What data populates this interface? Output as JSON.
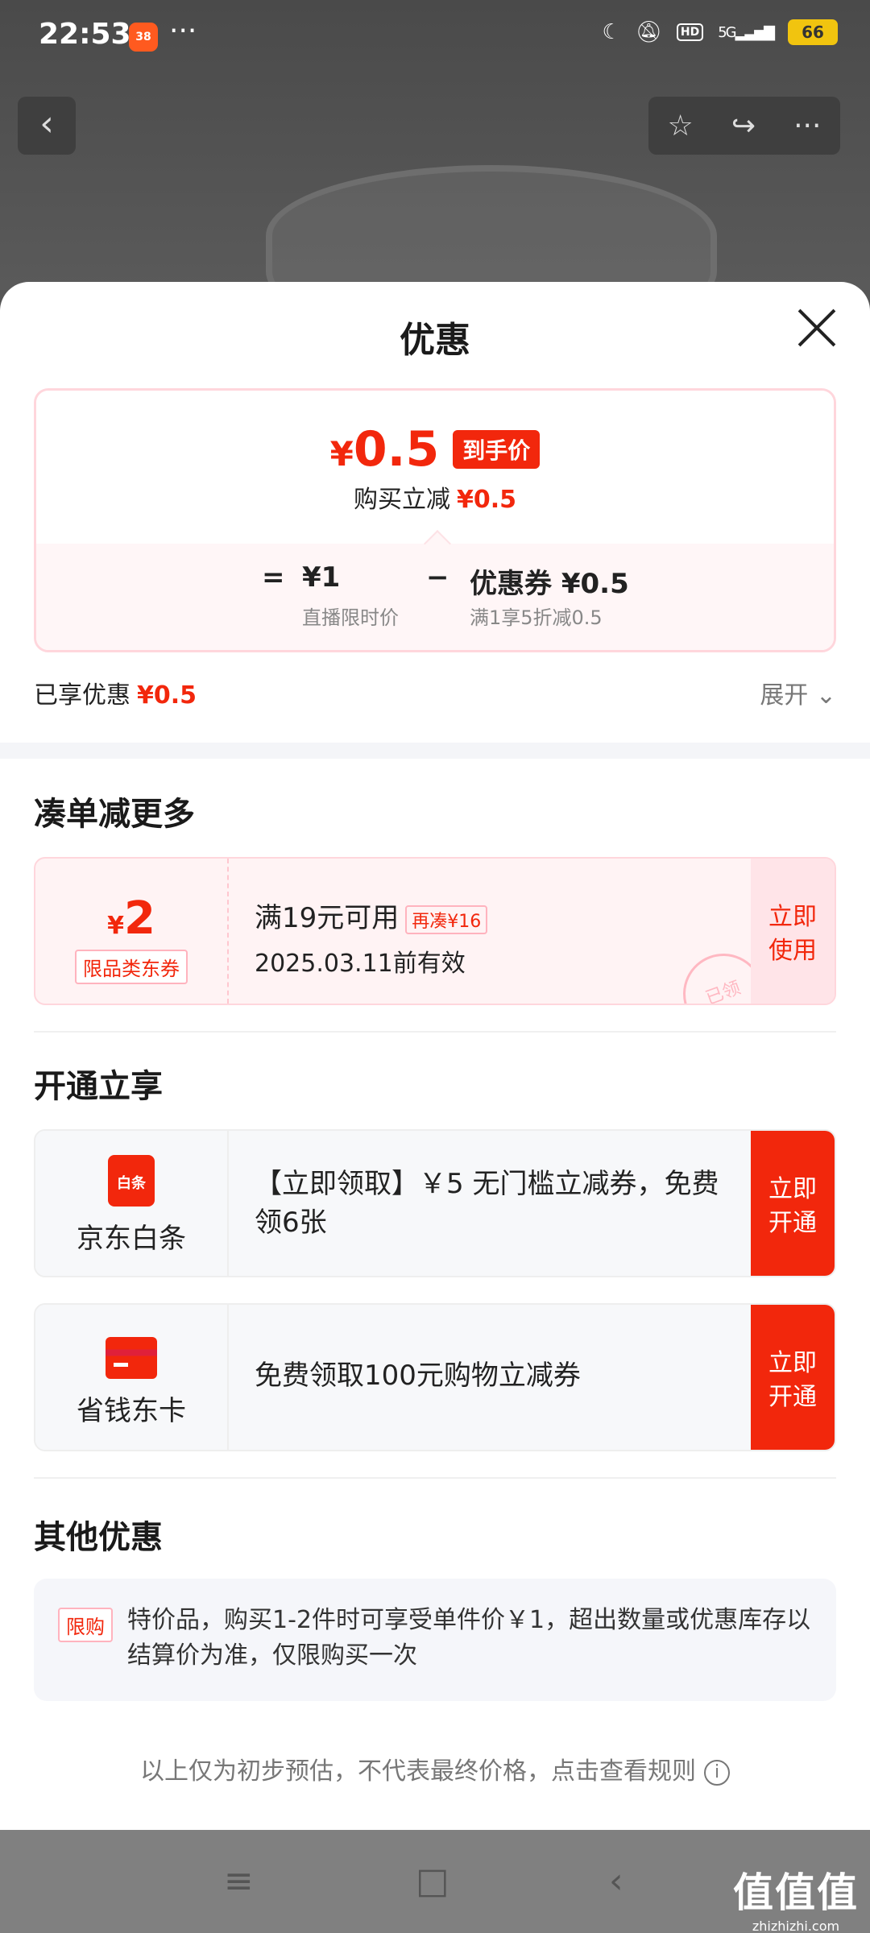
{
  "status_bar": {
    "time": "22:53",
    "app_badge": "38",
    "more": "···",
    "network": "5G",
    "hd": "HD",
    "battery": "66"
  },
  "header_nav": {
    "back": "‹",
    "star": "☆",
    "share": "↪",
    "more": "···"
  },
  "sheet": {
    "title": "优惠",
    "price_summary": {
      "final_price_symbol": "¥",
      "final_price": "0.5",
      "final_tag": "到手价",
      "instant_label": "购买立减",
      "instant_value": "¥0.5",
      "eq": "=",
      "base_price": "¥1",
      "base_note": "直播限时价",
      "minus": "−",
      "coupon_label": "优惠券 ¥0.5",
      "coupon_note": "满1享5折减0.5"
    },
    "enjoyed_label": "已享优惠",
    "enjoyed_value": "¥0.5",
    "expand_label": "展开 ⌄",
    "bundle_section": {
      "title": "凑单减更多",
      "coupon": {
        "currency": "¥",
        "amount": "2",
        "type": "限品类东券",
        "condition": "满19元可用",
        "more_tag": "再凑¥16",
        "validity": "2025.03.11前有效",
        "button": "立即使用",
        "stamp": "已领"
      }
    },
    "open_section": {
      "title": "开通立享",
      "items": [
        {
          "icon_text": "白条",
          "name": "京东白条",
          "text": "【立即领取】￥5 无门槛立减券，免费领6张",
          "button": "立即开通"
        },
        {
          "icon_text": "",
          "name": "省钱东卡",
          "text": "免费领取100元购物立减券",
          "button": "立即开通"
        }
      ]
    },
    "other_section": {
      "title": "其他优惠",
      "tag": "限购",
      "text": "特价品，购买1-2件时可享受单件价￥1，超出数量或优惠库存以结算价为准，仅限购买一次"
    },
    "footnote": "以上仅为初步预估，不代表最终价格，点击查看规则",
    "info": "i"
  },
  "system_nav": {
    "menu": "≡",
    "home": "□",
    "back": "‹"
  },
  "watermark": {
    "big": "值值值",
    "small": "zhizhizhi.com"
  },
  "colors": {
    "accent": "#f2270c",
    "overlay": "#555555"
  }
}
